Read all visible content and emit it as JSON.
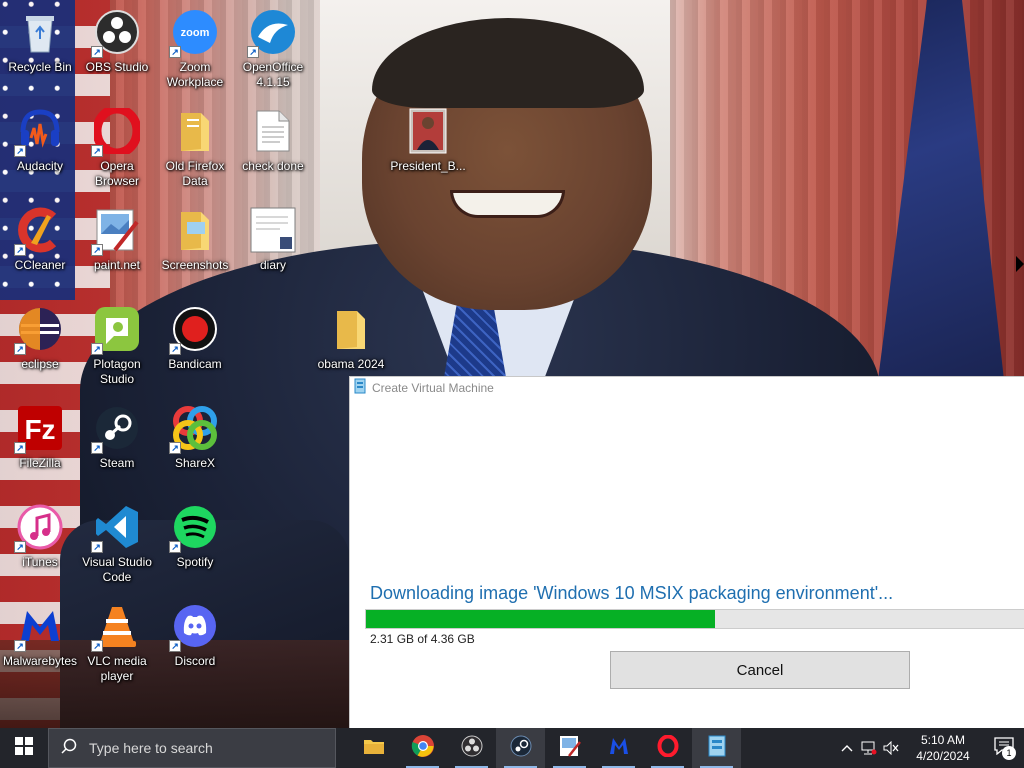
{
  "desktop": {
    "icons": [
      {
        "label": "Recycle Bin",
        "icon": "recycle-bin-icon"
      },
      {
        "label": "OBS Studio",
        "icon": "obs-studio-icon"
      },
      {
        "label": "Zoom Workplace",
        "icon": "zoom-icon"
      },
      {
        "label": "OpenOffice 4.1.15",
        "icon": "openoffice-icon"
      },
      {
        "label": "Audacity",
        "icon": "audacity-icon"
      },
      {
        "label": "Opera Browser",
        "icon": "opera-icon"
      },
      {
        "label": "Old Firefox Data",
        "icon": "folder-icon"
      },
      {
        "label": "check done",
        "icon": "text-file-icon"
      },
      {
        "label": "President_B...",
        "icon": "image-file-icon"
      },
      {
        "label": "CCleaner",
        "icon": "ccleaner-icon"
      },
      {
        "label": "paint.net",
        "icon": "paint-net-icon"
      },
      {
        "label": "Screenshots",
        "icon": "folder-icon"
      },
      {
        "label": "diary",
        "icon": "document-icon"
      },
      {
        "label": "eclipse",
        "icon": "eclipse-icon"
      },
      {
        "label": "Plotagon Studio",
        "icon": "plotagon-icon"
      },
      {
        "label": "Bandicam",
        "icon": "bandicam-icon"
      },
      {
        "label": "obama 2024",
        "icon": "folder-icon"
      },
      {
        "label": "FileZilla",
        "icon": "filezilla-icon"
      },
      {
        "label": "Steam",
        "icon": "steam-icon"
      },
      {
        "label": "ShareX",
        "icon": "sharex-icon"
      },
      {
        "label": "iTunes",
        "icon": "itunes-icon"
      },
      {
        "label": "Visual Studio Code",
        "icon": "vscode-icon"
      },
      {
        "label": "Spotify",
        "icon": "spotify-icon"
      },
      {
        "label": "Malwarebytes",
        "icon": "malwarebytes-icon"
      },
      {
        "label": "VLC media player",
        "icon": "vlc-icon"
      },
      {
        "label": "Discord",
        "icon": "discord-icon"
      }
    ]
  },
  "dialog": {
    "title": "Create Virtual Machine",
    "status": "Downloading image 'Windows 10 MSIX packaging environment'...",
    "progress_fraction": 0.53,
    "size_text": "2.31 GB of 4.36 GB",
    "cancel_label": "Cancel",
    "progress_color": "#06b025",
    "status_color": "#1f6fb0"
  },
  "taskbar": {
    "search_placeholder": "Type here to search",
    "apps": [
      {
        "name": "File Explorer",
        "icon": "file-explorer-icon"
      },
      {
        "name": "Google Chrome",
        "icon": "chrome-icon"
      },
      {
        "name": "OBS Studio",
        "icon": "obs-studio-icon"
      },
      {
        "name": "Steam",
        "icon": "steam-icon"
      },
      {
        "name": "paint.net",
        "icon": "paint-net-icon"
      },
      {
        "name": "Malwarebytes",
        "icon": "malwarebytes-icon"
      },
      {
        "name": "Opera",
        "icon": "opera-icon"
      },
      {
        "name": "Hyper-V Quick Create",
        "icon": "hyperv-icon"
      }
    ],
    "tray": {
      "time": "5:10 AM",
      "date": "4/20/2024",
      "notification_count": "1"
    }
  }
}
